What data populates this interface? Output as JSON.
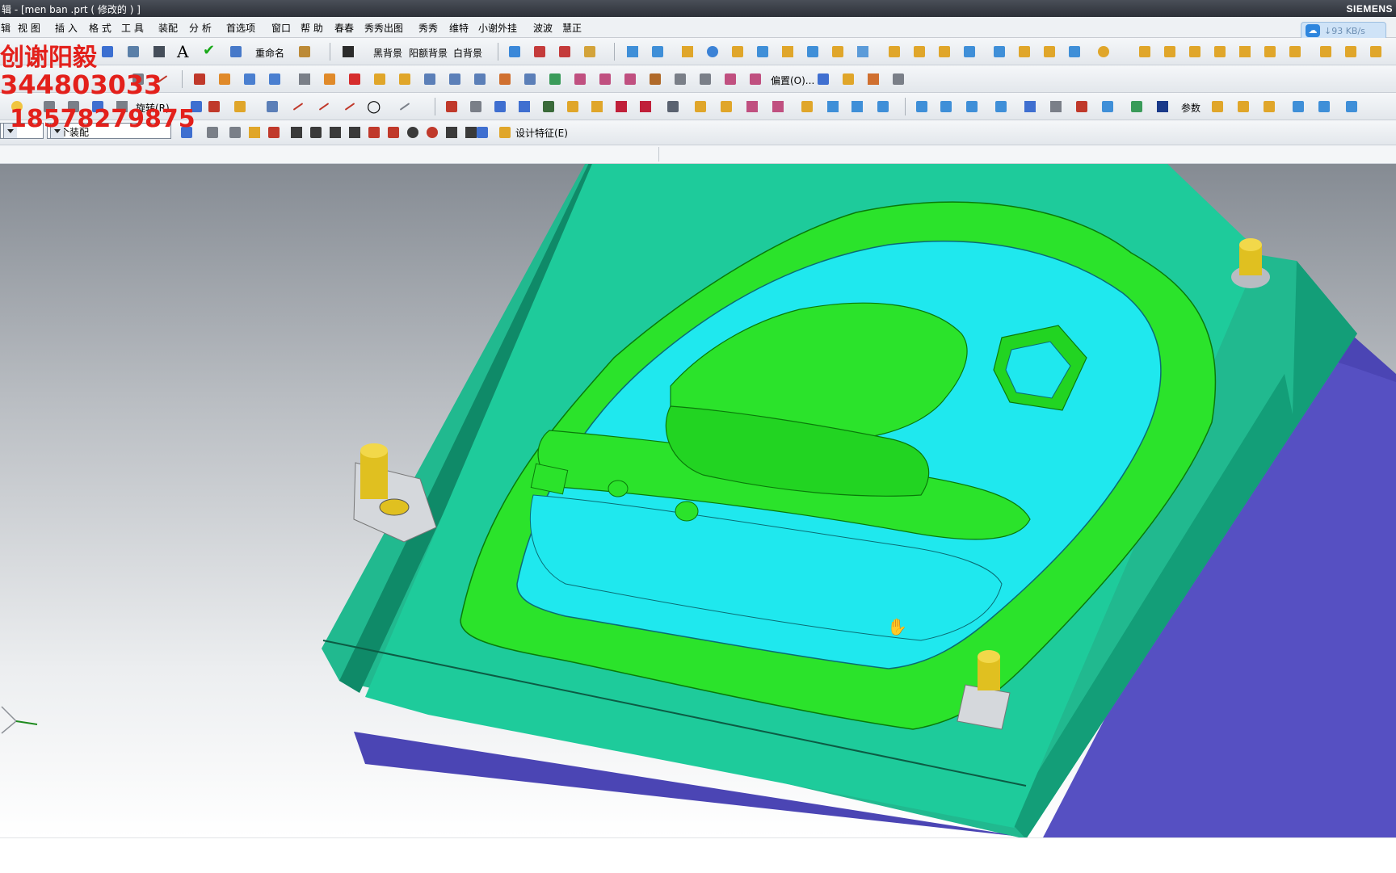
{
  "window": {
    "title": "辑 - [men ban .prt  ( 修改的 ) ]",
    "brand": "SIEMENS",
    "net_speed": "↓93 KB/s"
  },
  "menu": {
    "items": [
      "辑",
      "视 图",
      "插 入",
      "格 式",
      "工 具",
      "装配",
      "分 析",
      "首选项",
      "窗口",
      "帮 助",
      "春春",
      "秀秀出图",
      "秀秀",
      "维特",
      "小谢外挂",
      "波波",
      "慧正"
    ]
  },
  "toolbar": {
    "rename": "重命名",
    "black_bg": "黑背景",
    "gradient_bg": "阳额背景",
    "white_bg": "白背景",
    "rotate": "旋转(R)",
    "offset": "偏置(O)...",
    "params": "参数",
    "assembly_scope": "整个装配",
    "design_feature": "设计特征(E)"
  },
  "watermark": {
    "line1": "创谢阳毅",
    "line2": "344803033",
    "line3": "18578279875"
  },
  "colors": {
    "mold_base_top": "#1ecb9b",
    "mold_base_side": "#4b45b4",
    "core_green": "#2be32b",
    "cavity_cyan": "#1fe8ee",
    "guide_pin_yellow": "#e0c020"
  }
}
